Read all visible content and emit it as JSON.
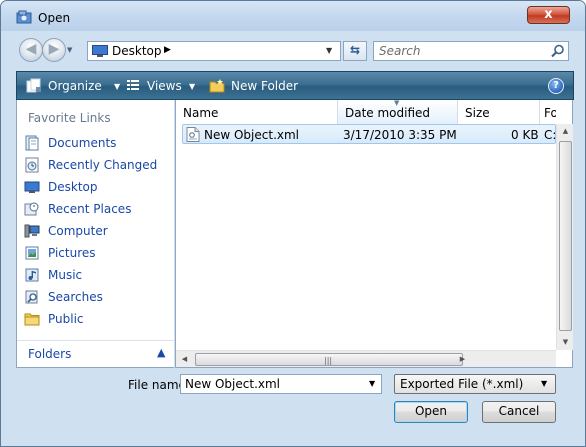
{
  "window": {
    "title": "Open",
    "close_glyph": "x"
  },
  "navigation": {
    "address": "Desktop",
    "search_placeholder": "Search"
  },
  "toolbar": {
    "organize": "Organize",
    "views": "Views",
    "new_folder": "New Folder"
  },
  "sidebar": {
    "heading": "Favorite Links",
    "items": [
      {
        "label": "Documents",
        "icon": "documents-icon"
      },
      {
        "label": "Recently Changed",
        "icon": "recently-changed-icon"
      },
      {
        "label": "Desktop",
        "icon": "desktop-icon"
      },
      {
        "label": "Recent Places",
        "icon": "recent-places-icon"
      },
      {
        "label": "Computer",
        "icon": "computer-icon"
      },
      {
        "label": "Pictures",
        "icon": "pictures-icon"
      },
      {
        "label": "Music",
        "icon": "music-icon"
      },
      {
        "label": "Searches",
        "icon": "searches-icon"
      },
      {
        "label": "Public",
        "icon": "public-folder-icon"
      }
    ],
    "folders_label": "Folders"
  },
  "file_list": {
    "columns": [
      "Name",
      "Date modified",
      "Size",
      "Fo"
    ],
    "sorted_column": "Date modified",
    "rows": [
      {
        "name": "New Object.xml",
        "date_modified": "3/17/2010 3:35 PM",
        "size": "0 KB",
        "folder": "C:"
      }
    ]
  },
  "footer": {
    "file_name_label": "File name:",
    "file_name_value": "New Object.xml",
    "file_type": "Exported File (*.xml)",
    "open_button": "Open",
    "cancel_button": "Cancel"
  },
  "colors": {
    "toolbar": "#2a5c80",
    "link": "#1a48a8",
    "selection": "#d7eafb",
    "close_button": "#c13b22"
  }
}
